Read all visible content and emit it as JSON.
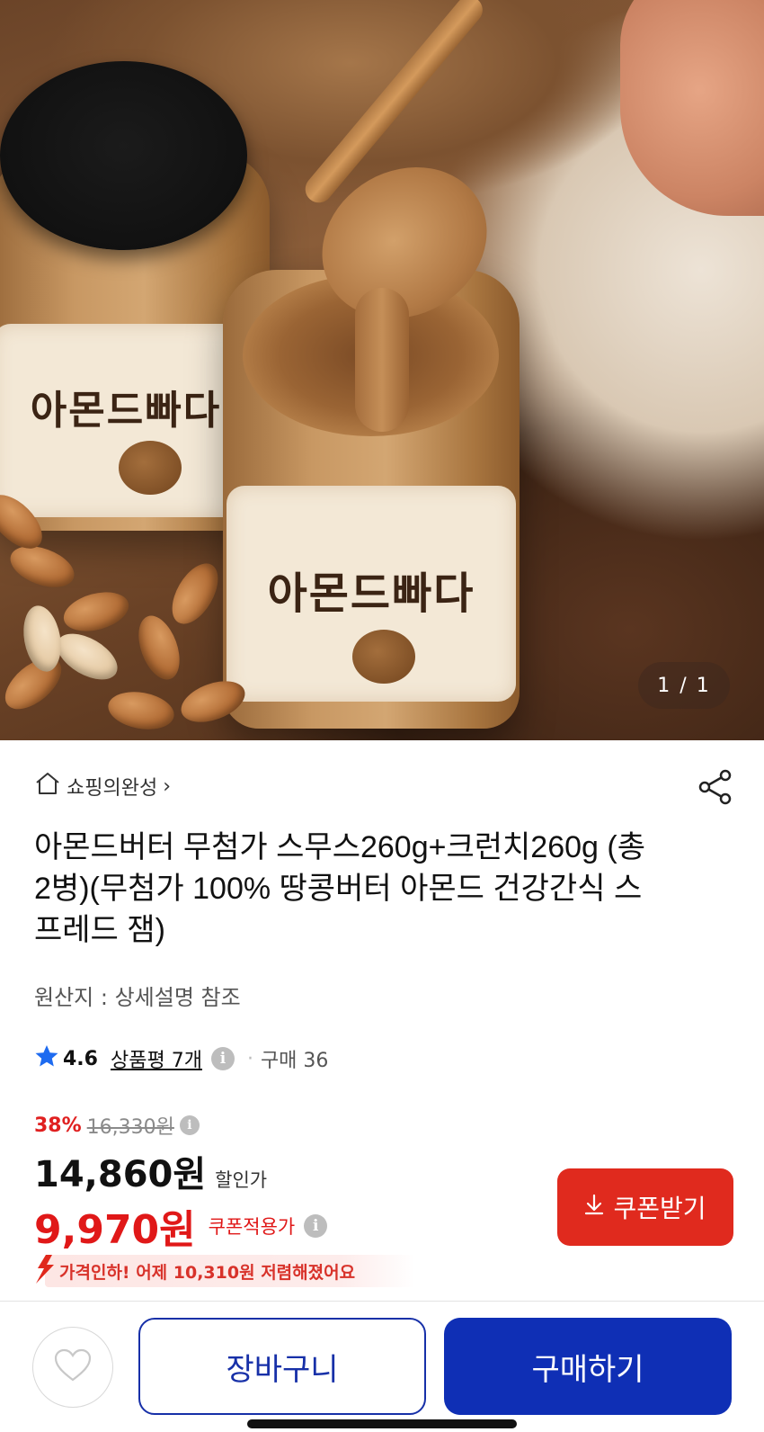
{
  "hero": {
    "image_counter": "1 / 1",
    "jar_label": "아몬드빠다"
  },
  "store": {
    "name": "쇼핑의완성",
    "chevron": "›"
  },
  "product": {
    "title": "아몬드버터 무첨가 스무스260g+크런치260g (총 2병)(무첨가 100% 땅콩버터 아몬드 건강간식 스프레드 잼)",
    "origin": "원산지 : 상세설명 참조"
  },
  "rating": {
    "score": "4.6",
    "review_link": "상품평 7개",
    "separator": "·",
    "purchases": "구매 36"
  },
  "pricing": {
    "discount_percent": "38%",
    "original_price": "16,330원",
    "sale_price": "14,860원",
    "sale_label": "할인가",
    "coupon_price": "9,970원",
    "coupon_label": "쿠폰적용가",
    "coupon_button": "쿠폰받기",
    "info_glyph": "i",
    "price_drop_notice": "가격인하! 어제 10,310원 저렴해졌어요"
  },
  "actions": {
    "cart": "장바구니",
    "buy": "구매하기"
  },
  "colors": {
    "accent_red": "#e02a1e",
    "primary_blue": "#0f2fb5",
    "star_blue": "#1e6bf0"
  },
  "icons": {
    "home": "home-icon",
    "share": "share-icon",
    "star": "star-icon",
    "info": "info-icon",
    "download": "download-icon",
    "heart": "heart-icon",
    "price_drop": "down-arrow-icon"
  }
}
